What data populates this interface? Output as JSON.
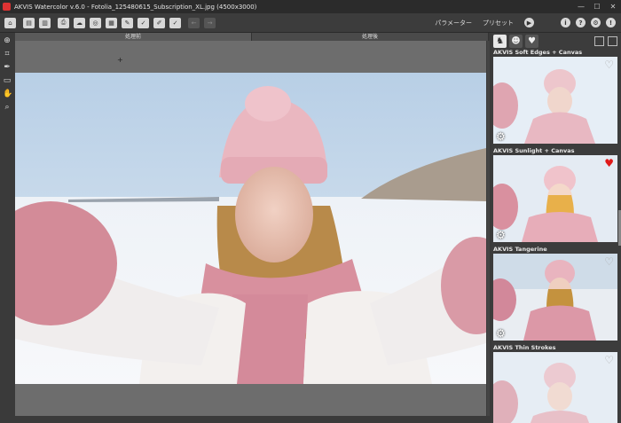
{
  "window": {
    "title": "AKVIS Watercolor v.6.0 - Fotolia_125480615_Subscription_XL.jpg (4500x3000)",
    "controls": [
      "—",
      "☐",
      "✕"
    ]
  },
  "toolbar": {
    "params_label": "パラメーター",
    "presets_label": "プリセット",
    "run_symbol": "▶",
    "info_symbol": "i",
    "help_symbol": "?",
    "settings_symbol": "⚙",
    "news_symbol": "!"
  },
  "tabs": {
    "before": "処理前",
    "after": "処理後"
  },
  "presets": [
    {
      "name": "AKVIS Soft Edges + Canvas",
      "favorite": false
    },
    {
      "name": "AKVIS Sunlight + Canvas",
      "favorite": true
    },
    {
      "name": "AKVIS Tangerine",
      "favorite": false
    },
    {
      "name": "AKVIS Thin Strokes",
      "favorite": false
    }
  ],
  "colors": {
    "favorite_heart": "#e01818",
    "sky": "#c9dcec",
    "hat": "#eab7c0"
  }
}
